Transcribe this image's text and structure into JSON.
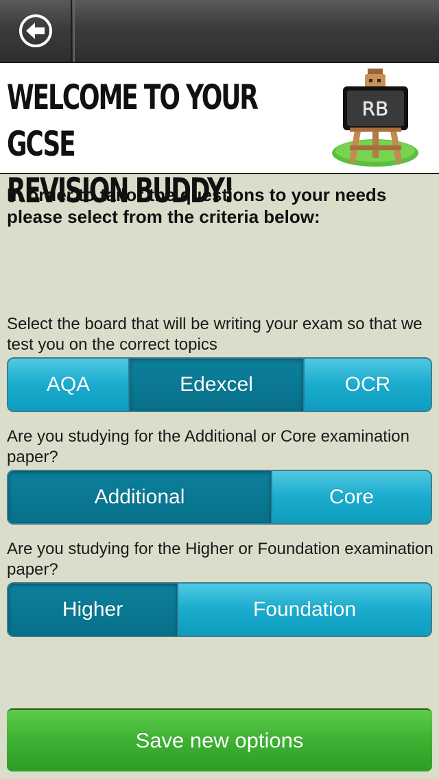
{
  "nav": {
    "back_icon": "back-arrow-icon"
  },
  "header": {
    "title_line1": "WELCOME TO YOUR GCSE",
    "title_line2": "REVISION BUDDY!",
    "logo_text": "RB"
  },
  "intro": "In order to tailor the questions to your needs please select from the criteria below:",
  "board": {
    "question": "Select the board that will be writing your exam so that we test you on the correct topics",
    "options": [
      "AQA",
      "Edexcel",
      "OCR"
    ],
    "selected": "Edexcel"
  },
  "paper_type": {
    "question": "Are you studying for the Additional or Core examination paper?",
    "options": [
      "Additional",
      "Core"
    ],
    "selected": "Additional"
  },
  "tier": {
    "question": "Are you studying for the Higher or Foundation examination paper?",
    "options": [
      "Higher",
      "Foundation"
    ],
    "selected": "Higher"
  },
  "save_label": "Save new options",
  "colors": {
    "segment": "#19abcd",
    "segment_selected": "#0a7893",
    "save": "#3db132",
    "background": "#d9ddc9"
  }
}
